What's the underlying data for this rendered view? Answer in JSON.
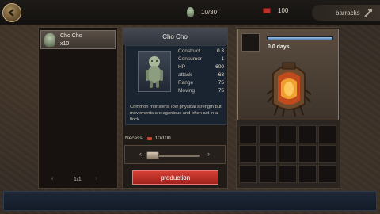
{
  "topbar": {
    "monster_count": "10/30",
    "brick_count": "100",
    "tab_label": "barracks"
  },
  "list": {
    "items": [
      {
        "name": "Cho Cho",
        "count": "x10"
      }
    ],
    "pager": "1/1"
  },
  "detail": {
    "title": "Cho Cho",
    "stats": [
      {
        "label": "Construct",
        "value": "0.3"
      },
      {
        "label": "Consumer",
        "value": "1"
      },
      {
        "label": "HP",
        "value": "600"
      },
      {
        "label": "attack",
        "value": "68"
      },
      {
        "label": "Range",
        "value": "75"
      },
      {
        "label": "Moving",
        "value": "75"
      }
    ],
    "description": "Common monsters, low physical strength but movements are agonious and often act in a flock.",
    "necess_label": "Necess",
    "necess_value": "10/100",
    "quantity_level": 0.0,
    "production_label": "production"
  },
  "preview": {
    "days": "0.0 days",
    "progress": 1.0
  },
  "colors": {
    "accent_red": "#c83328",
    "progress_blue": "#6a9fd0"
  }
}
